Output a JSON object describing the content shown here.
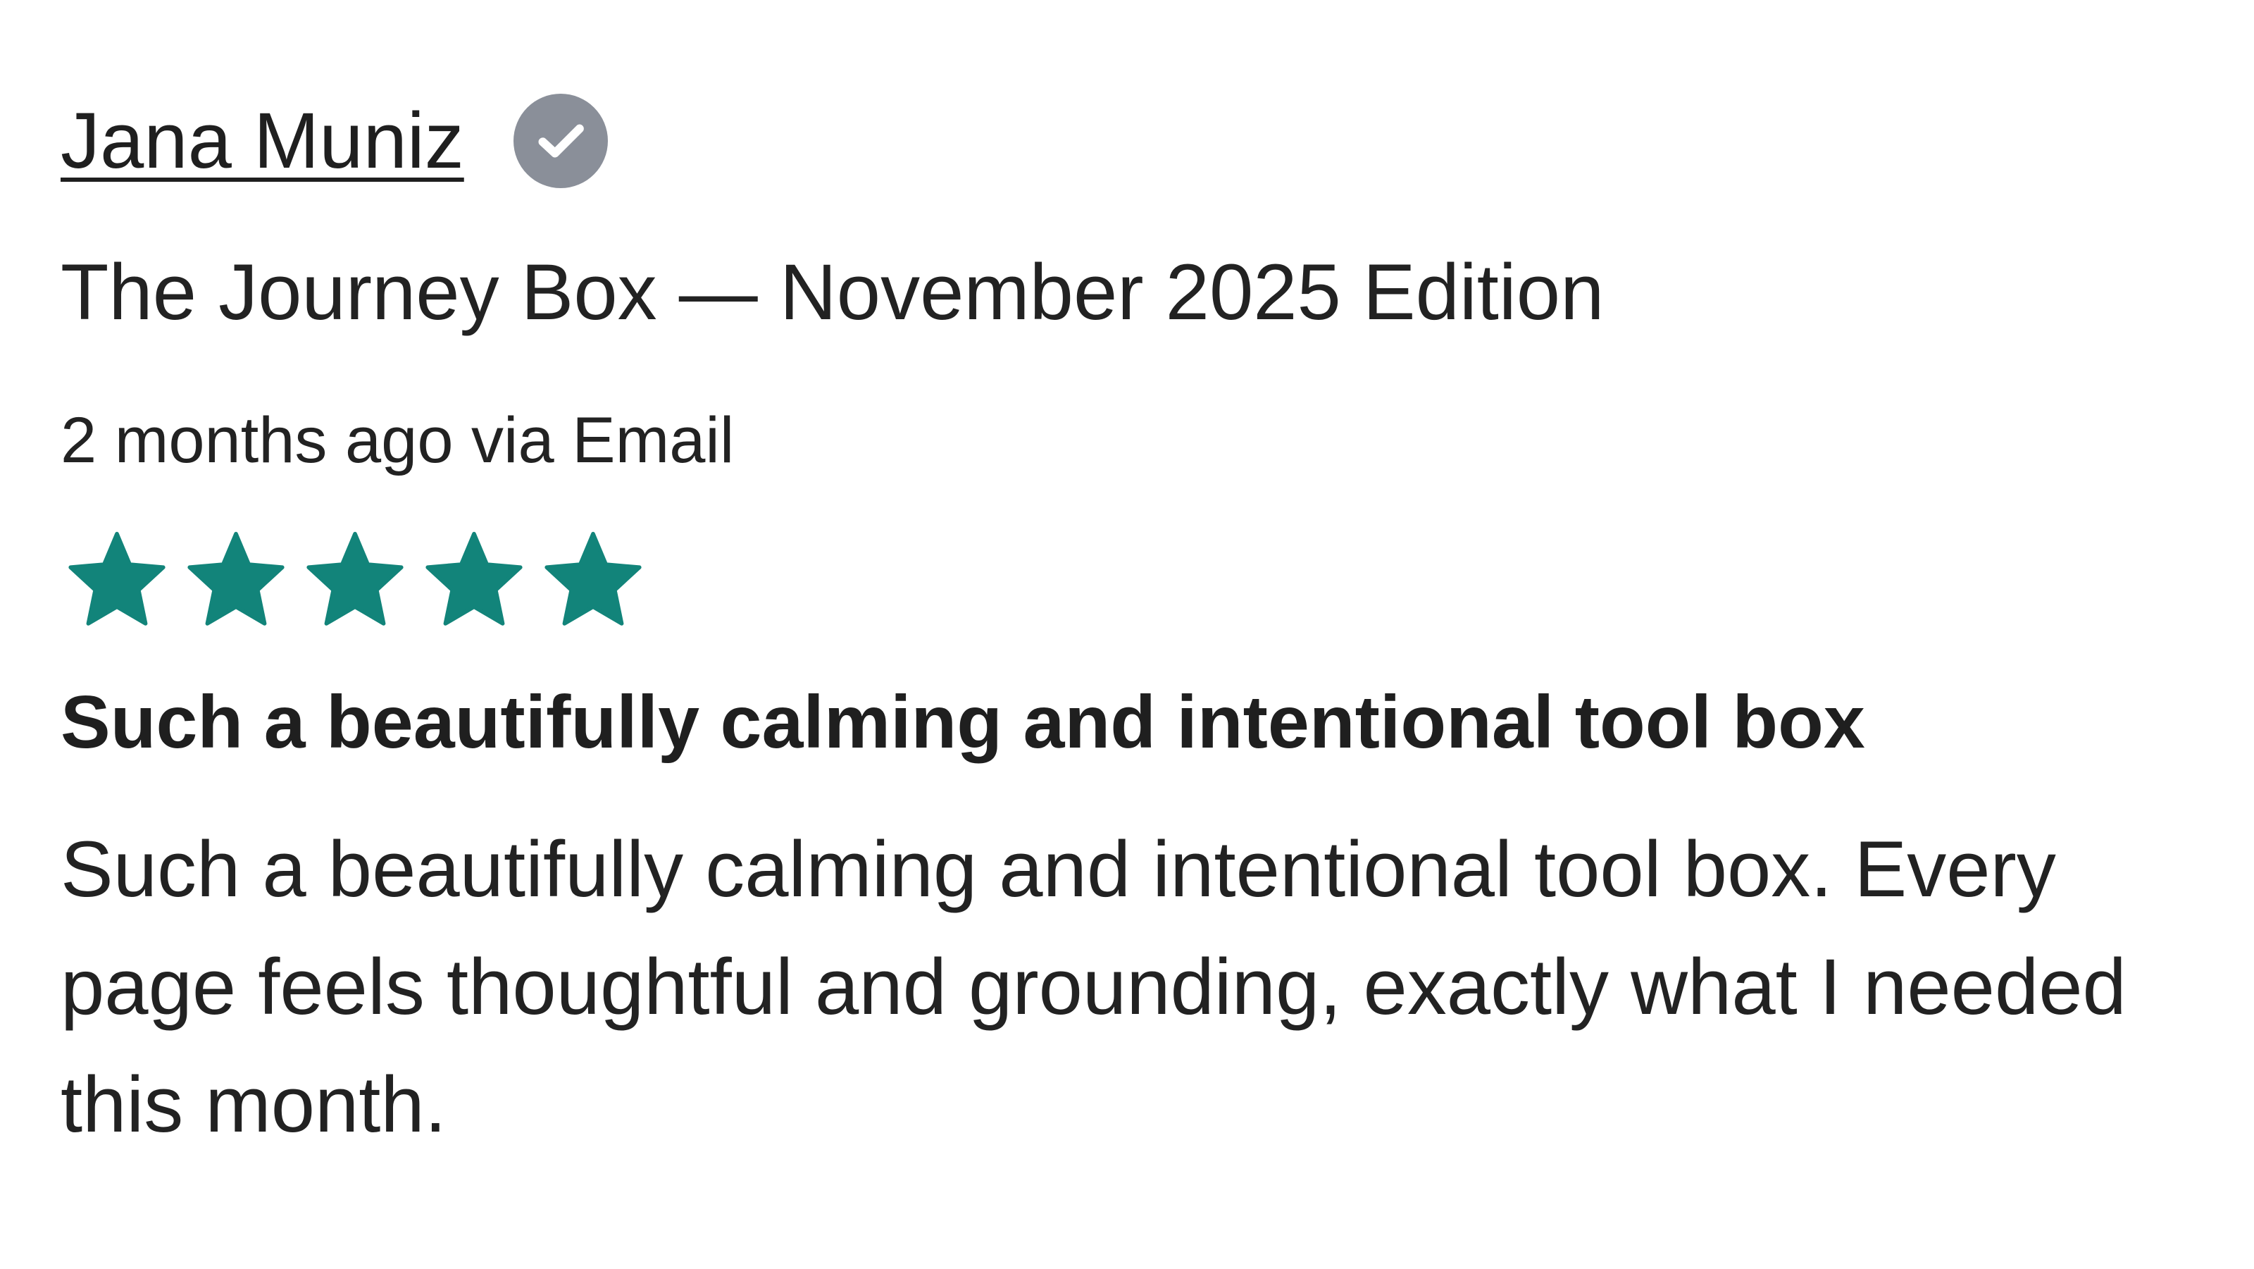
{
  "review": {
    "author": "Jana Muniz",
    "verified_icon": "verified-check-icon",
    "product": "The Journey Box — November 2025 Edition",
    "meta": "2 months ago via Email",
    "rating": 5,
    "rating_max": 5,
    "star_icon": "star-icon",
    "title": "Such a beautifully calming and intentional tool box",
    "body": "Such a beautifully calming and intentional tool box. Every page feels thoughtful and grounding, exactly what I needed this month."
  },
  "colors": {
    "star": "#12847a",
    "verified_badge": "#8a8f99",
    "text": "#1f1f1f"
  }
}
